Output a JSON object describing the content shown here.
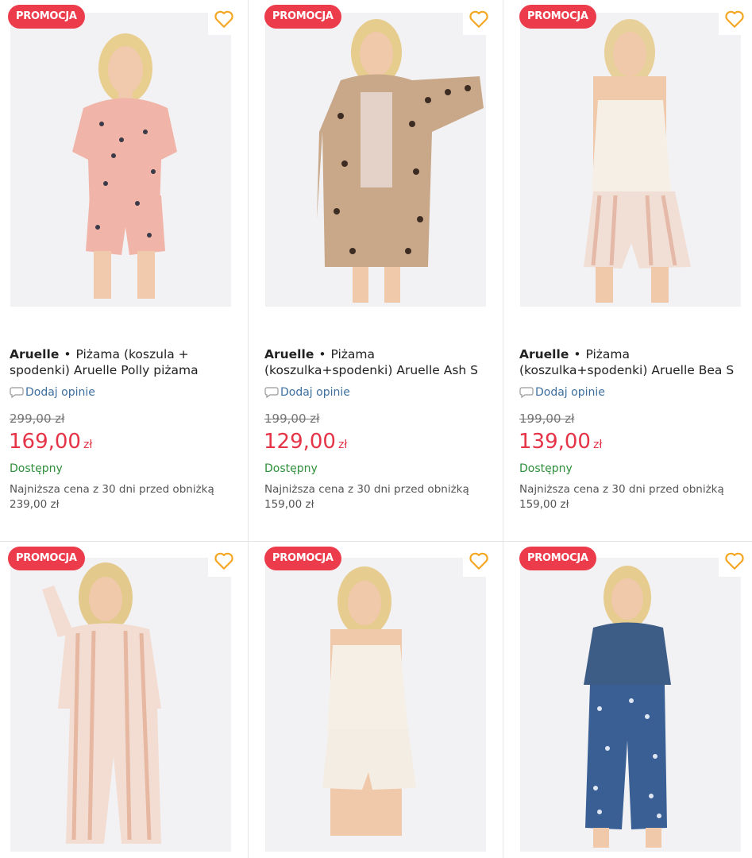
{
  "products": [
    {
      "badge": "PROMOCJA",
      "brand": "Aruelle",
      "separator": "•",
      "name": "Piżama (koszula + spodenki) Aruelle Polly piżama",
      "opinion": "Dodaj opinie",
      "old_price": "299,00 zł",
      "price": "169,00",
      "currency": "zł",
      "availability": "Dostępny",
      "lowest_label": "Najniższa cena z 30 dni przed obniżką",
      "lowest_price": "239,00 zł",
      "garment": "pink-shirt-shorts"
    },
    {
      "badge": "PROMOCJA",
      "brand": "Aruelle",
      "separator": "•",
      "name": "Piżama (koszulka+spodenki) Aruelle Ash S",
      "opinion": "Dodaj opinie",
      "old_price": "199,00 zł",
      "price": "129,00",
      "currency": "zł",
      "availability": "Dostępny",
      "lowest_label": "Najniższa cena z 30 dni przed obniżką",
      "lowest_price": "159,00 zł",
      "garment": "leopard-robe"
    },
    {
      "badge": "PROMOCJA",
      "brand": "Aruelle",
      "separator": "•",
      "name": "Piżama (koszulka+spodenki) Aruelle Bea S",
      "opinion": "Dodaj opinie",
      "old_price": "199,00 zł",
      "price": "139,00",
      "currency": "zł",
      "availability": "Dostępny",
      "lowest_label": "Najniższa cena z 30 dni przed obniżką",
      "lowest_price": "159,00 zł",
      "garment": "cream-cami-striped-shorts"
    },
    {
      "badge": "PROMOCJA",
      "garment": "striped-long-pajama"
    },
    {
      "badge": "PROMOCJA",
      "garment": "cream-cami-lace-shorts"
    },
    {
      "badge": "PROMOCJA",
      "garment": "navy-tee-printed-pants"
    }
  ],
  "icons": {
    "favorite": "heart-outline-icon",
    "opinion": "speech-bubble-icon"
  },
  "colors": {
    "promo": "#ec3b4b",
    "price": "#e53447",
    "available": "#2f8f3a",
    "heart": "#f5a623",
    "link": "#3c6e9e"
  }
}
